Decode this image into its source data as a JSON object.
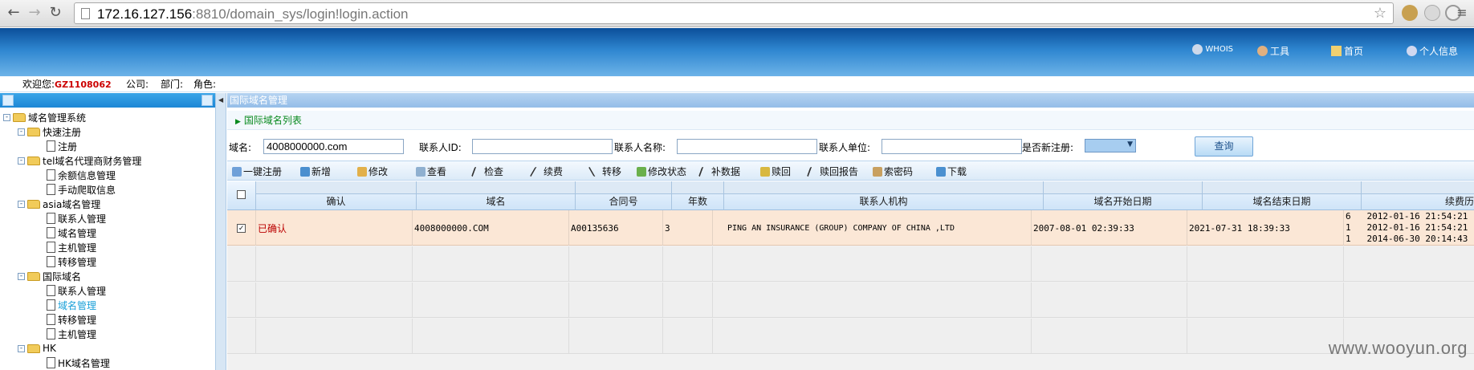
{
  "browser": {
    "url_host": "172.16.127.156",
    "url_path": ":8810/domain_sys/login!login.action"
  },
  "header": {
    "links": [
      {
        "label": "WHOIS"
      },
      {
        "label": "工具"
      },
      {
        "label": "首页"
      },
      {
        "label": "个人信息"
      }
    ]
  },
  "welcome": {
    "prefix": "欢迎您:",
    "user": "GZ1108062",
    "company": "公司:",
    "dept": "部门:",
    "role": "角色:"
  },
  "tree": {
    "items": [
      {
        "label": "域名管理系统"
      },
      {
        "label": "快速注册"
      },
      {
        "label": "注册"
      },
      {
        "label": "tel域名代理商财务管理"
      },
      {
        "label": "余额信息管理"
      },
      {
        "label": "手动爬取信息"
      },
      {
        "label": "asia域名管理"
      },
      {
        "label": "联系人管理"
      },
      {
        "label": "域名管理"
      },
      {
        "label": "主机管理"
      },
      {
        "label": "转移管理"
      },
      {
        "label": "国际域名"
      },
      {
        "label": "联系人管理"
      },
      {
        "label": "域名管理"
      },
      {
        "label": "转移管理"
      },
      {
        "label": "主机管理"
      },
      {
        "label": "HK"
      },
      {
        "label": "HK域名管理"
      }
    ]
  },
  "main": {
    "panel_title": "国际域名管理",
    "list_title": "国际域名列表",
    "search": {
      "domain_label": "域名:",
      "domain_value": "4008000000.com",
      "contact_id_label": "联系人ID:",
      "contact_name_label": "联系人名称:",
      "contact_org_label": "联系人单位:",
      "is_new_label": "是否新注册:",
      "query_label": "查询"
    },
    "toolbar": [
      {
        "label": "一键注册"
      },
      {
        "label": "新增"
      },
      {
        "label": "修改"
      },
      {
        "label": "查看"
      },
      {
        "label": "检查"
      },
      {
        "label": "续费"
      },
      {
        "label": "转移"
      },
      {
        "label": "修改状态"
      },
      {
        "label": "补数据"
      },
      {
        "label": "赎回"
      },
      {
        "label": "赎回报告"
      },
      {
        "label": "索密码"
      },
      {
        "label": "下载"
      }
    ],
    "columns": [
      "确认",
      "域名",
      "合同号",
      "年数",
      "联系人机构",
      "域名开始日期",
      "域名结束日期",
      "续费历"
    ],
    "rows": [
      {
        "status": "已确认",
        "domain": "4008000000.COM",
        "contract": "A00135636",
        "years": "3",
        "org": "PING AN INSURANCE (GROUP) COMPANY OF CHINA ,LTD",
        "start": "2007-08-01 02:39:33",
        "end": "2021-07-31 18:39:33",
        "history": [
          "6   2012-01-16 21:54:21",
          "1   2012-01-16 21:54:21",
          "1   2014-06-30 20:14:43"
        ]
      }
    ]
  },
  "watermark": "www.wooyun.org"
}
